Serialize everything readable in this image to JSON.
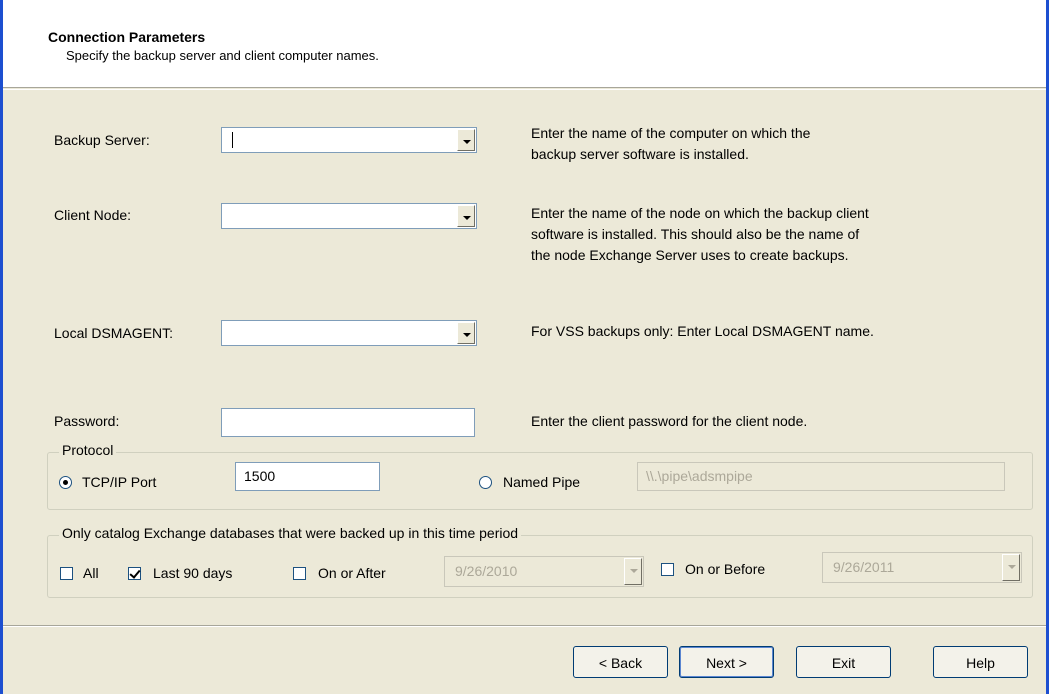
{
  "header": {
    "title": "Connection Parameters",
    "subtitle": "Specify the backup server and client computer names."
  },
  "fields": {
    "backup_server": {
      "label": "Backup Server:",
      "value": "",
      "desc_line1": "Enter the name of the computer on which the",
      "desc_line2": "backup server software is installed."
    },
    "client_node": {
      "label": "Client Node:",
      "value": "",
      "desc_line1": "Enter the name of the node on which the backup client",
      "desc_line2": "software is installed.  This should also be the name of",
      "desc_line3": "the node Exchange Server uses to create backups."
    },
    "local_dsmagent": {
      "label": "Local DSMAGENT:",
      "value": "",
      "desc": "For VSS backups only: Enter Local DSMAGENT name."
    },
    "password": {
      "label": "Password:",
      "value": "",
      "desc": "Enter the client password for the client node."
    }
  },
  "protocol": {
    "group_label": "Protocol",
    "tcp_label": "TCP/IP Port",
    "tcp_selected": true,
    "tcp_port": "1500",
    "pipe_label": "Named Pipe",
    "pipe_selected": false,
    "pipe_value": "\\\\.\\pipe\\adsmpipe"
  },
  "catalog": {
    "group_label": "Only catalog Exchange databases that were backed up in this time period",
    "all_label": "All",
    "all_checked": false,
    "last90_label": "Last 90 days",
    "last90_checked": true,
    "on_after_label": "On or After",
    "on_after_checked": false,
    "on_after_date": "9/26/2010",
    "on_before_label": "On or Before",
    "on_before_checked": false,
    "on_before_date": "9/26/2011"
  },
  "buttons": {
    "back": "< Back",
    "next": "Next >",
    "exit": "Exit",
    "help": "Help"
  },
  "colors": {
    "window_border": "#1d4fd0",
    "dialog_bg": "#ece9d8",
    "header_bg": "#ffffff"
  }
}
